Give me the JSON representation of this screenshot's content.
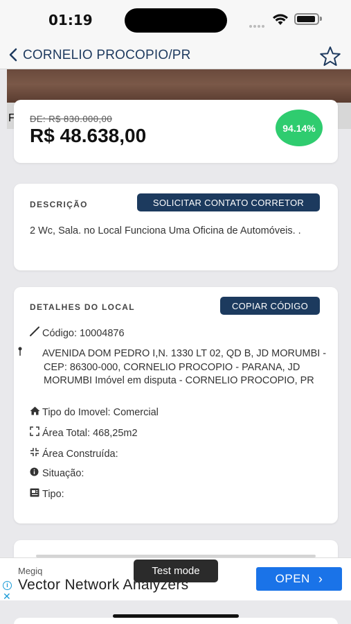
{
  "status_bar": {
    "time": "01:19"
  },
  "nav": {
    "title": "CORNELIO PROCOPIO/PR"
  },
  "hero": {
    "partial_letter": "F"
  },
  "price": {
    "old": "DE: R$ 830.000,00",
    "current": "R$ 48.638,00",
    "discount": "94.14%"
  },
  "description": {
    "label": "DESCRIÇÃO",
    "contact_button": "SOLICITAR CONTATO CORRETOR",
    "text": "2 Wc, Sala. no Local Funciona Uma Oficina de Automóveis. ."
  },
  "details": {
    "label": "DETALHES DO LOCAL",
    "copy_button": "COPIAR CÓDIGO",
    "rows": [
      {
        "icon": "pencil-icon",
        "text": "Código: 10004876"
      },
      {
        "icon": "pin-icon",
        "text": "AVENIDA DOM PEDRO I,N. 1330 LT 02, QD B, JD MORUMBI - CEP: 86300-000, CORNELIO PROCOPIO - PARANA, JD MORUMBI  Imóvel em disputa - CORNELIO PROCOPIO, PR"
      },
      {
        "icon": "home-icon",
        "text": "Tipo do Imovel: Comercial"
      },
      {
        "icon": "expand-icon",
        "text": "Área Total: 468,25m2"
      },
      {
        "icon": "compress-icon",
        "text": "Área Construída:"
      },
      {
        "icon": "info-icon",
        "text": "Situação:"
      },
      {
        "icon": "document-icon",
        "text": "Tipo:"
      }
    ]
  },
  "ad": {
    "brand": "Megiq",
    "headline": "Vector Network Analyzers",
    "test_mode": "Test mode",
    "open_button": "OPEN"
  },
  "colors": {
    "accent": "#1c3a5e",
    "discount_green": "#2fcc6f",
    "ad_blue": "#1a73e8"
  }
}
